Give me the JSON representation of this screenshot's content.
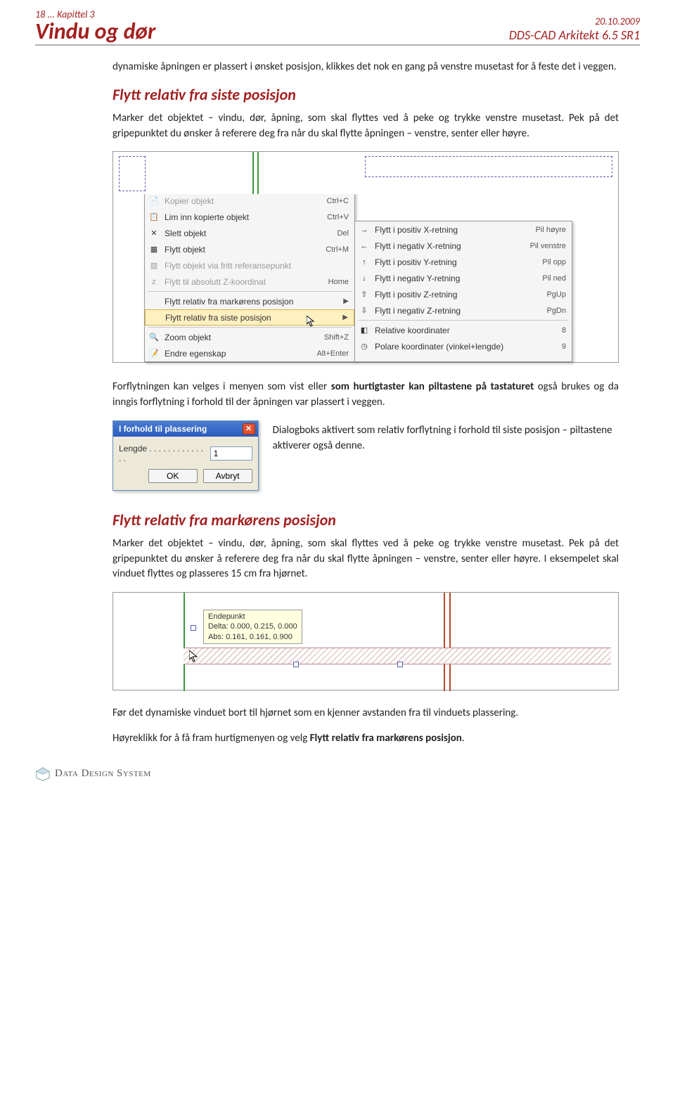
{
  "header": {
    "chapter": "18 ... Kapittel 3",
    "title": "Vindu og dør",
    "date": "20.10.2009",
    "product": "DDS-CAD Arkitekt 6.5 SR1"
  },
  "intro_para": "dynamiske åpningen er plassert i ønsket posisjon, klikkes det nok en gang på venstre musetast for å feste det i veggen.",
  "section1": {
    "heading": "Flytt relativ fra siste posisjon",
    "para": "Marker det objektet – vindu, dør, åpning, som skal flyttes ved å peke og trykke venstre musetast. Pek på det gripepunktet du ønsker å referere deg fra når du skal flytte åpningen – venstre, senter eller høyre."
  },
  "menu_left": [
    {
      "icon": "copy",
      "label": "Kopier objekt",
      "shortcut": "Ctrl+C",
      "disabled": true
    },
    {
      "icon": "paste",
      "label": "Lim inn kopierte objekt",
      "shortcut": "Ctrl+V",
      "disabled": false
    },
    {
      "icon": "delete",
      "label": "Slett objekt",
      "shortcut": "Del",
      "disabled": false
    },
    {
      "icon": "move",
      "label": "Flytt objekt",
      "shortcut": "Ctrl+M",
      "disabled": false
    },
    {
      "icon": "moveref",
      "label": "Flytt objekt via fritt referansepunkt",
      "shortcut": "",
      "disabled": true
    },
    {
      "icon": "z",
      "label": "Flytt til absolutt Z-koordinat",
      "shortcut": "Home",
      "disabled": true
    },
    {
      "icon": "",
      "label": "Flytt relativ fra markørens posisjon",
      "shortcut": "",
      "submenu": true,
      "disabled": false
    },
    {
      "icon": "",
      "label": "Flytt relativ fra siste posisjon",
      "shortcut": "",
      "submenu": true,
      "disabled": false,
      "hover": true
    },
    {
      "icon": "zoom",
      "label": "Zoom objekt",
      "shortcut": "Shift+Z",
      "disabled": false
    },
    {
      "icon": "prop",
      "label": "Endre egenskap",
      "shortcut": "Alt+Enter",
      "disabled": false
    }
  ],
  "menu_right": [
    {
      "icon": "→",
      "label": "Flytt i positiv X-retning",
      "shortcut": "Pil høyre"
    },
    {
      "icon": "←",
      "label": "Flytt i negativ X-retning",
      "shortcut": "Pil venstre"
    },
    {
      "icon": "↑",
      "label": "Flytt i positiv Y-retning",
      "shortcut": "Pil opp"
    },
    {
      "icon": "↓",
      "label": "Flytt i negativ Y-retning",
      "shortcut": "Pil ned"
    },
    {
      "icon": "⇧",
      "label": "Flytt i positiv Z-retning",
      "shortcut": "PgUp"
    },
    {
      "icon": "⇩",
      "label": "Flytt i negativ Z-retning",
      "shortcut": "PgDn"
    },
    {
      "icon": "◧",
      "label": "Relative koordinater",
      "shortcut": "8"
    },
    {
      "icon": "◷",
      "label": "Polare koordinater (vinkel+lengde)",
      "shortcut": "9"
    }
  ],
  "mid_para_parts": {
    "a": "Forflytningen kan velges i menyen som vist eller ",
    "b": "som hurtigtaster kan piltastene på tastaturet",
    "c": " også brukes og da inngis forflytning i forhold til der åpningen var plassert i veggen."
  },
  "dialog": {
    "title": "I forhold til plassering",
    "field_label": "Lengde . . . . . . . . . . . . . .",
    "field_value": "1",
    "ok": "OK",
    "cancel": "Avbryt"
  },
  "dialog_caption": "Dialogboks aktivert som relativ forflytning i forhold til siste posisjon – piltastene aktiverer også denne.",
  "section2": {
    "heading": "Flytt relativ fra markørens posisjon",
    "para": "Marker det objektet – vindu, dør, åpning, som skal flyttes ved å peke og trykke venstre musetast. Pek på det gripepunktet du ønsker å referere deg fra når du skal flytte åpningen – venstre, senter eller høyre.  I eksempelet skal vinduet flyttes og plasseres 15 cm fra hjørnet."
  },
  "tooltip": {
    "l1": "Endepunkt",
    "l2": "Delta: 0.000, 0.215, 0.000",
    "l3": "Abs: 0.161, 0.161, 0.900"
  },
  "closing_para1": "Før det dynamiske vinduet bort til hjørnet som en kjenner avstanden fra til vinduets plassering.",
  "closing_para2_a": "Høyreklikk for å få fram hurtigmenyen og velg ",
  "closing_para2_b": "Flytt relativ fra markørens posisjon",
  "closing_para2_c": ".",
  "footer": {
    "company": "Data Design System"
  }
}
